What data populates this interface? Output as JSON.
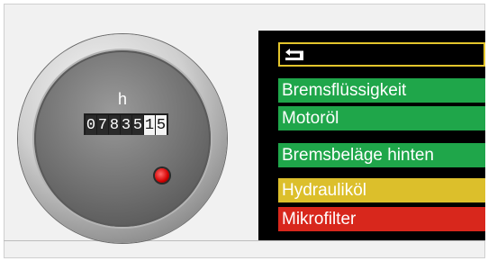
{
  "hour_meter": {
    "unit_label": "h",
    "digits": [
      {
        "value": "0",
        "style": "dark"
      },
      {
        "value": "7",
        "style": "dark"
      },
      {
        "value": "8",
        "style": "dark"
      },
      {
        "value": "3",
        "style": "dark"
      },
      {
        "value": "5",
        "style": "dark"
      },
      {
        "value": "1",
        "style": "light"
      },
      {
        "value": "5",
        "style": "light"
      }
    ],
    "indicator_color": "#d40000"
  },
  "menu": {
    "back_icon": "back-arrow-icon",
    "highlight_color": "#e3c52c",
    "items": [
      {
        "label": "Bremsflüssigkeit",
        "color": "#1fa64a"
      },
      {
        "label": "Motoröl",
        "color": "#1fa64a"
      },
      {
        "label": "Bremsbeläge hinten",
        "color": "#1fa64a"
      },
      {
        "label": "Hydrauliköl",
        "color": "#dcbf2b"
      },
      {
        "label": "Mikrofilter",
        "color": "#d8271c"
      }
    ]
  }
}
